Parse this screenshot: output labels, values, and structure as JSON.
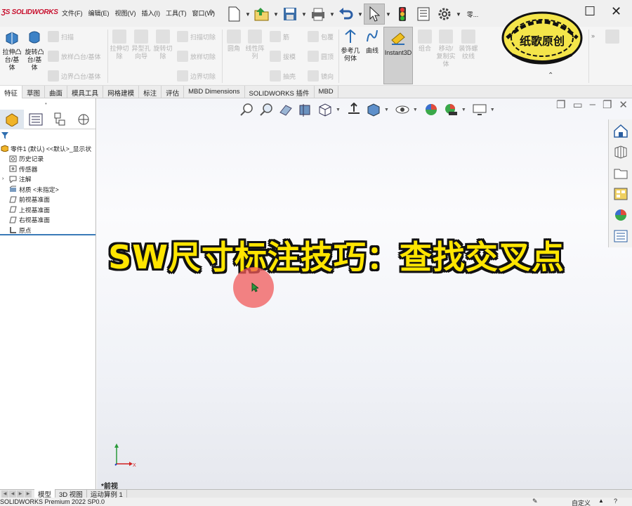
{
  "app": {
    "logo": "SOLIDWORKS",
    "menu": [
      "文件(F)",
      "编辑(E)",
      "视图(V)",
      "插入(I)",
      "工具(T)",
      "窗口(W)"
    ],
    "quick_more": "零..."
  },
  "ribbon": {
    "extrude_boss": "拉伸凸\n台/基\n体",
    "revolve_boss": "旋转凸\n台/基\n体",
    "sweep": "扫描",
    "loft_boss": "放样凸台/基体",
    "boundary_boss": "边界凸台/基体",
    "extrude_cut": "拉伸切\n除",
    "hole_wizard": "异型孔\n向导",
    "revolve_cut": "旋转切\n除",
    "swept_cut": "扫描切除",
    "lofted_cut": "放样切除",
    "boundary_cut": "边界切除",
    "fillet": "圆角",
    "linear_pattern": "线性阵\n列",
    "rib": "筋",
    "draft": "拔模",
    "shell": "抽壳",
    "wrap": "包覆",
    "intersect": "圆顶",
    "mirror": "镜向",
    "ref_geometry": "参考几\n何体",
    "curves": "曲线",
    "instant3d": "Instant3D",
    "combine": "组合",
    "move_copy": "移动/\n复制实\n体",
    "thread": "装饰螺\n纹线"
  },
  "tabs": [
    "特征",
    "草图",
    "曲面",
    "模具工具",
    "网格建模",
    "标注",
    "评估",
    "MBD Dimensions",
    "SOLIDWORKS 插件",
    "MBD"
  ],
  "tree": [
    {
      "label": "零件1 (默认) <<默认>_显示状",
      "icon": "part-icon"
    },
    {
      "label": "历史记录",
      "icon": "history-icon"
    },
    {
      "label": "传感器",
      "icon": "sensor-icon"
    },
    {
      "label": "注解",
      "icon": "annotation-icon"
    },
    {
      "label": "材质 <未指定>",
      "icon": "material-icon"
    },
    {
      "label": "前视基准面",
      "icon": "plane-icon"
    },
    {
      "label": "上视基准面",
      "icon": "plane-icon"
    },
    {
      "label": "右视基准面",
      "icon": "plane-icon"
    },
    {
      "label": "原点",
      "icon": "origin-icon"
    }
  ],
  "graphics": {
    "caption": "SW尺寸标注技巧：查找交叉点",
    "view_name": "*前视",
    "triad_x": "X"
  },
  "watermark": {
    "text": "纸歌原创"
  },
  "bottom_tabs": [
    "模型",
    "3D 视图",
    "运动算例 1"
  ],
  "status": {
    "version": "SOLIDWORKS Premium 2022 SP0.0",
    "custom": "自定义"
  },
  "colors": {
    "caption_fill": "#ffe500",
    "cursor_ring": "#f05a5a",
    "brand_red": "#c8102e"
  }
}
